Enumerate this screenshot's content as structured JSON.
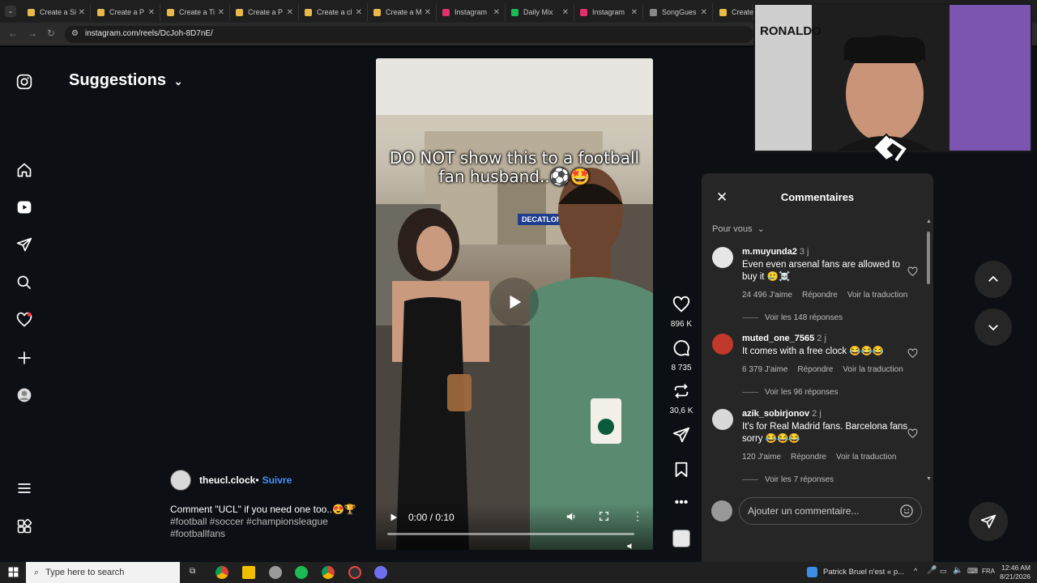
{
  "browser": {
    "tabs": [
      {
        "label": "Create a Si",
        "icon_color": "#e8b84a"
      },
      {
        "label": "Create a P",
        "icon_color": "#e8b84a"
      },
      {
        "label": "Create a Ti",
        "icon_color": "#e8b84a"
      },
      {
        "label": "Create a P",
        "icon_color": "#e8b84a"
      },
      {
        "label": "Create a cl",
        "icon_color": "#e8b84a"
      },
      {
        "label": "Create a M",
        "icon_color": "#e8b84a"
      },
      {
        "label": "Instagram",
        "icon_color": "#e1306c"
      },
      {
        "label": "Daily Mix",
        "icon_color": "#1db954"
      },
      {
        "label": "Instagram",
        "icon_color": "#e1306c"
      },
      {
        "label": "SongGues",
        "icon_color": "#888888"
      },
      {
        "label": "Create",
        "icon_color": "#e8b84a"
      }
    ],
    "url": "instagram.com/reels/DcJoh-8D7nE/"
  },
  "sidebar": {
    "suggestions_label": "Suggestions"
  },
  "video": {
    "caption": "DO NOT show this to a football fan husband..⚽🤩",
    "store_sign": "DECATLON",
    "timecode": "0:00 / 0:10"
  },
  "actions": {
    "likes": "896 K",
    "comments": "8 735",
    "reposts": "30,6 K"
  },
  "post": {
    "author": "theucl.clock",
    "separator": " •",
    "follow": "Suivre",
    "caption": "Comment \"UCL\" if you need one too..😍🏆",
    "hashtags": "#football #soccer #championsleague #footballfans"
  },
  "comments_panel": {
    "title": "Commentaires",
    "sort": "Pour vous",
    "input_placeholder": "Ajouter un commentaire...",
    "reply_label": "Répondre",
    "translate_label": "Voir la traduction",
    "items": [
      {
        "user": "m.muyunda2",
        "age": "3 j",
        "text": "Even even arsenal fans are allowed to buy it 🥲☠️",
        "likes": "24 496 J'aime",
        "replies": "Voir les 148 réponses",
        "avatar_color": "#e6e6e6"
      },
      {
        "user": "muted_one_7565",
        "age": "2 j",
        "text": "It comes with a free clock 😂😂😂",
        "likes": "6 379 J'aime",
        "replies": "Voir les 96 réponses",
        "avatar_color": "#c0392b"
      },
      {
        "user": "azik_sobirjonov",
        "age": "2 j",
        "text": "It's for Real Madrid fans. Barcelona fans sorry 😂😂😂",
        "likes": "120 J'aime",
        "replies": "Voir les 7 réponses",
        "avatar_color": "#d8d8d8"
      }
    ]
  },
  "webcam": {
    "jersey_text": "RONALDO"
  },
  "taskbar": {
    "search_placeholder": "Type here to search",
    "now_playing": "Patrick Bruel n'est « p...",
    "language": "FRA",
    "time": "12:46 AM",
    "date": "8/21/2026"
  }
}
